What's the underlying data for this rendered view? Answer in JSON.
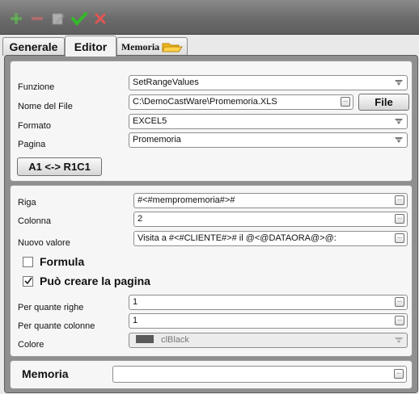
{
  "toolbar": {
    "icons": [
      "plus-icon",
      "minus-icon",
      "edit-icon",
      "checkmark-icon",
      "close-icon"
    ]
  },
  "tabs": [
    {
      "label": "Generale"
    },
    {
      "label": "Editor"
    },
    {
      "label": "Memoria"
    }
  ],
  "form_top": {
    "funzione": {
      "label": "Funzione",
      "value": "SetRangeValues"
    },
    "nome_file": {
      "label": "Nome del File",
      "value": "C:\\DemoCastWare\\Promemoria.XLS",
      "button": "File"
    },
    "formato": {
      "label": "Formato",
      "value": "EXCEL5"
    },
    "pagina": {
      "label": "Pagina",
      "value": "Promemoria"
    },
    "a1_button": "A1 <-> R1C1"
  },
  "form_mid": {
    "riga": {
      "label": "Riga",
      "value": "#<#mempromemoria#>#"
    },
    "colonna": {
      "label": "Colonna",
      "value": "2"
    },
    "nuovo_valore": {
      "label": "Nuovo valore",
      "value": "Visita a #<#CLIENTE#># il @<@DATAORA@>@:"
    },
    "formula": {
      "label": "Formula",
      "checked": false
    },
    "puo_creare": {
      "label": "Può creare la pagina",
      "checked": true
    },
    "per_quante_righe": {
      "label": "Per quante righe",
      "value": "1"
    },
    "per_quante_colonne": {
      "label": "Per quante colonne",
      "value": "1"
    },
    "colore": {
      "label": "Colore",
      "value": "clBlack",
      "swatch": "#5a5a5a"
    }
  },
  "memoria": {
    "label": "Memoria",
    "value": ""
  },
  "colors": {
    "add": "#5ec94a",
    "minus": "#e36b6b",
    "check": "#35b82b",
    "close": "#e25555"
  }
}
